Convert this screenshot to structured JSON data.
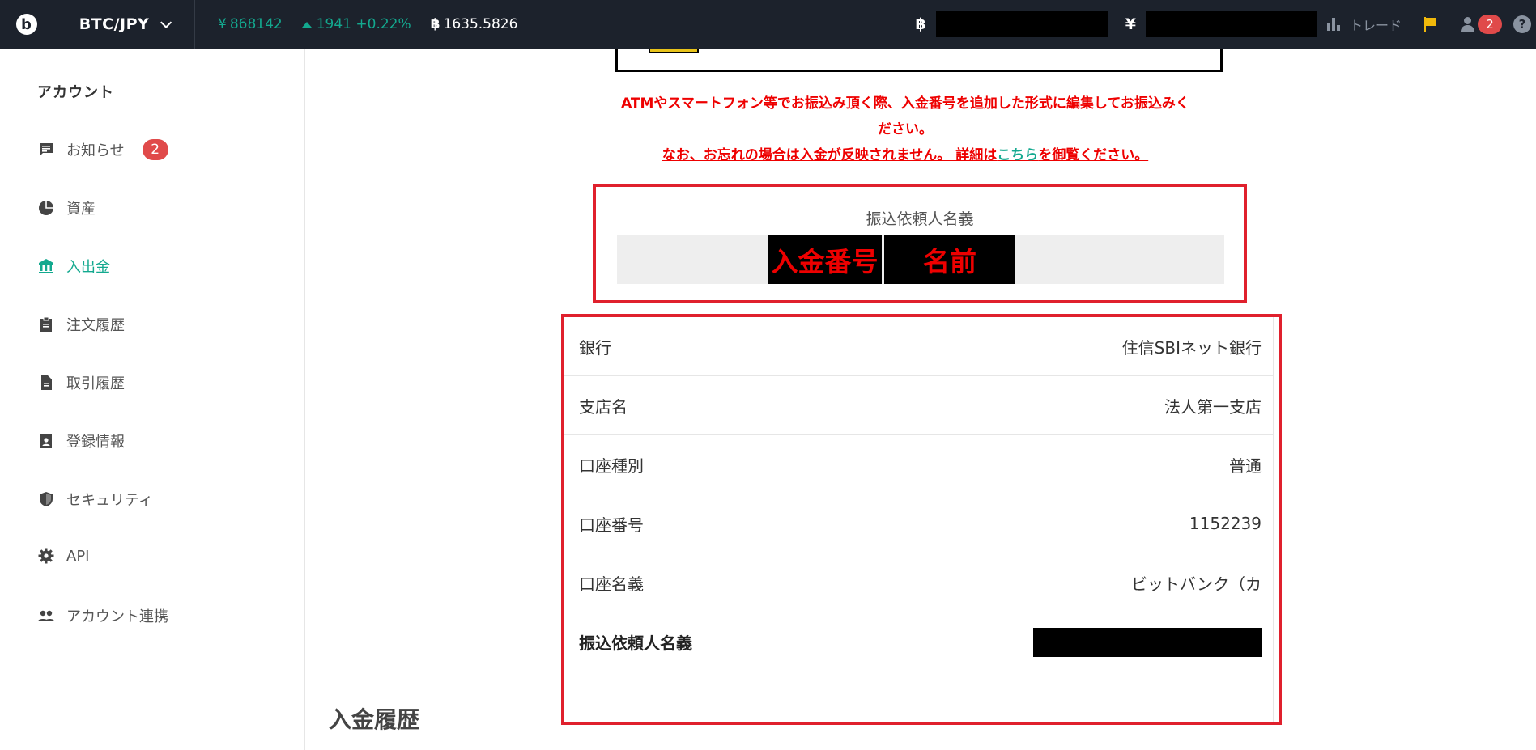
{
  "topbar": {
    "pair": "BTC/JPY",
    "price": "868142",
    "change": "1941 +0.22%",
    "btc_value": "1635.5826",
    "trade_label": "トレード",
    "notifications_count": "2",
    "help_label": "?"
  },
  "sidebar": {
    "title": "アカウント",
    "items": [
      {
        "label": "お知らせ",
        "icon": "message-icon",
        "badge": "2"
      },
      {
        "label": "資産",
        "icon": "pie-chart-icon"
      },
      {
        "label": "入出金",
        "icon": "bank-icon",
        "active": true
      },
      {
        "label": "注文履歴",
        "icon": "clipboard-icon"
      },
      {
        "label": "取引履歴",
        "icon": "document-icon"
      },
      {
        "label": "登録情報",
        "icon": "contact-card-icon"
      },
      {
        "label": "セキュリティ",
        "icon": "shield-icon"
      },
      {
        "label": "API",
        "icon": "gear-icon"
      },
      {
        "label": "アカウント連携",
        "icon": "people-icon"
      }
    ]
  },
  "notice": {
    "line1": "ATMやスマートフォン等でお振込み頂く際、入金番号を追加した形式に編集してお振込みく",
    "line2": "ださい。",
    "line3_pre": "なお、お忘れの場合は入金が反映されません。 詳細は",
    "line3_link": "こちら",
    "line3_post": "を御覧ください。"
  },
  "transfer_name": {
    "label": "振込依頼人名義",
    "part1": "入金番号",
    "part2": "名前"
  },
  "bank_info": {
    "rows": [
      {
        "key": "銀行",
        "value": "住信SBIネット銀行"
      },
      {
        "key": "支店名",
        "value": "法人第一支店"
      },
      {
        "key": "口座種別",
        "value": "普通"
      },
      {
        "key": "口座番号",
        "value": "1152239"
      },
      {
        "key": "口座名義",
        "value": "ビットバンク（カ"
      },
      {
        "key": "振込依頼人名義",
        "value": ""
      }
    ]
  },
  "history_title": "入金履歴",
  "colors": {
    "accent": "#13a98f",
    "alert": "#e00000",
    "highlight_border": "#e0202d",
    "topbar_bg": "#1c222c"
  }
}
